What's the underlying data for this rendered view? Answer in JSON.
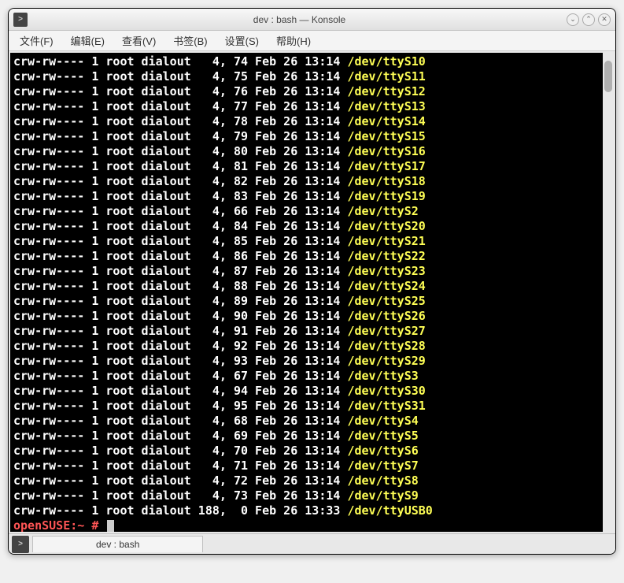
{
  "window": {
    "title": "dev : bash — Konsole"
  },
  "menu": {
    "file": "文件(F)",
    "edit": "编辑(E)",
    "view": "查看(V)",
    "bookmarks": "书签(B)",
    "settings": "设置(S)",
    "help": "帮助(H)"
  },
  "terminal": {
    "lines": [
      {
        "perm": "crw-rw---- 1 root dialout   4, 74 Feb 26 13:14 ",
        "path": "/dev/ttyS10"
      },
      {
        "perm": "crw-rw---- 1 root dialout   4, 75 Feb 26 13:14 ",
        "path": "/dev/ttyS11"
      },
      {
        "perm": "crw-rw---- 1 root dialout   4, 76 Feb 26 13:14 ",
        "path": "/dev/ttyS12"
      },
      {
        "perm": "crw-rw---- 1 root dialout   4, 77 Feb 26 13:14 ",
        "path": "/dev/ttyS13"
      },
      {
        "perm": "crw-rw---- 1 root dialout   4, 78 Feb 26 13:14 ",
        "path": "/dev/ttyS14"
      },
      {
        "perm": "crw-rw---- 1 root dialout   4, 79 Feb 26 13:14 ",
        "path": "/dev/ttyS15"
      },
      {
        "perm": "crw-rw---- 1 root dialout   4, 80 Feb 26 13:14 ",
        "path": "/dev/ttyS16"
      },
      {
        "perm": "crw-rw---- 1 root dialout   4, 81 Feb 26 13:14 ",
        "path": "/dev/ttyS17"
      },
      {
        "perm": "crw-rw---- 1 root dialout   4, 82 Feb 26 13:14 ",
        "path": "/dev/ttyS18"
      },
      {
        "perm": "crw-rw---- 1 root dialout   4, 83 Feb 26 13:14 ",
        "path": "/dev/ttyS19"
      },
      {
        "perm": "crw-rw---- 1 root dialout   4, 66 Feb 26 13:14 ",
        "path": "/dev/ttyS2"
      },
      {
        "perm": "crw-rw---- 1 root dialout   4, 84 Feb 26 13:14 ",
        "path": "/dev/ttyS20"
      },
      {
        "perm": "crw-rw---- 1 root dialout   4, 85 Feb 26 13:14 ",
        "path": "/dev/ttyS21"
      },
      {
        "perm": "crw-rw---- 1 root dialout   4, 86 Feb 26 13:14 ",
        "path": "/dev/ttyS22"
      },
      {
        "perm": "crw-rw---- 1 root dialout   4, 87 Feb 26 13:14 ",
        "path": "/dev/ttyS23"
      },
      {
        "perm": "crw-rw---- 1 root dialout   4, 88 Feb 26 13:14 ",
        "path": "/dev/ttyS24"
      },
      {
        "perm": "crw-rw---- 1 root dialout   4, 89 Feb 26 13:14 ",
        "path": "/dev/ttyS25"
      },
      {
        "perm": "crw-rw---- 1 root dialout   4, 90 Feb 26 13:14 ",
        "path": "/dev/ttyS26"
      },
      {
        "perm": "crw-rw---- 1 root dialout   4, 91 Feb 26 13:14 ",
        "path": "/dev/ttyS27"
      },
      {
        "perm": "crw-rw---- 1 root dialout   4, 92 Feb 26 13:14 ",
        "path": "/dev/ttyS28"
      },
      {
        "perm": "crw-rw---- 1 root dialout   4, 93 Feb 26 13:14 ",
        "path": "/dev/ttyS29"
      },
      {
        "perm": "crw-rw---- 1 root dialout   4, 67 Feb 26 13:14 ",
        "path": "/dev/ttyS3"
      },
      {
        "perm": "crw-rw---- 1 root dialout   4, 94 Feb 26 13:14 ",
        "path": "/dev/ttyS30"
      },
      {
        "perm": "crw-rw---- 1 root dialout   4, 95 Feb 26 13:14 ",
        "path": "/dev/ttyS31"
      },
      {
        "perm": "crw-rw---- 1 root dialout   4, 68 Feb 26 13:14 ",
        "path": "/dev/ttyS4"
      },
      {
        "perm": "crw-rw---- 1 root dialout   4, 69 Feb 26 13:14 ",
        "path": "/dev/ttyS5"
      },
      {
        "perm": "crw-rw---- 1 root dialout   4, 70 Feb 26 13:14 ",
        "path": "/dev/ttyS6"
      },
      {
        "perm": "crw-rw---- 1 root dialout   4, 71 Feb 26 13:14 ",
        "path": "/dev/ttyS7"
      },
      {
        "perm": "crw-rw---- 1 root dialout   4, 72 Feb 26 13:14 ",
        "path": "/dev/ttyS8"
      },
      {
        "perm": "crw-rw---- 1 root dialout   4, 73 Feb 26 13:14 ",
        "path": "/dev/ttyS9"
      },
      {
        "perm": "crw-rw---- 1 root dialout 188,  0 Feb 26 13:33 ",
        "path": "/dev/ttyUSB0"
      }
    ],
    "prompt_host": "openSUSE:~ #",
    "prompt_input": " "
  },
  "tabbar": {
    "tab1": "dev : bash"
  },
  "controls": {
    "minimize": "⌄",
    "maximize": "⌃",
    "close": "✕"
  }
}
